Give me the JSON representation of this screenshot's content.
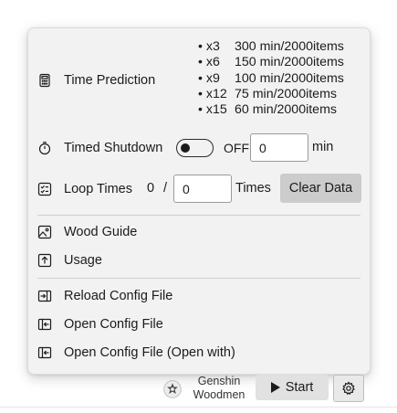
{
  "time_prediction": {
    "label": "Time Prediction",
    "icon": "calculator-icon",
    "entries": [
      {
        "multiplier": "x3",
        "time": "300 min/2000items"
      },
      {
        "multiplier": "x6",
        "time": "150 min/2000items"
      },
      {
        "multiplier": "x9",
        "time": "100 min/2000items"
      },
      {
        "multiplier": "x12",
        "time": "75 min/2000items"
      },
      {
        "multiplier": "x15",
        "time": "60 min/2000items"
      }
    ]
  },
  "timed_shutdown": {
    "label": "Timed Shutdown",
    "icon": "timer-icon",
    "toggle_state": "OFF",
    "toggle_on": false,
    "minutes_value": "0",
    "unit": "min"
  },
  "loop_times": {
    "label": "Loop Times",
    "icon": "checklist-icon",
    "current": "0",
    "divider": "/",
    "total_value": "0",
    "unit": "Times",
    "clear_button": "Clear Data"
  },
  "menu_group_1": [
    {
      "label": "Wood Guide",
      "icon": "image-icon"
    },
    {
      "label": "Usage",
      "icon": "upload-icon"
    }
  ],
  "menu_group_2": [
    {
      "label": "Reload Config File",
      "icon": "import-icon"
    },
    {
      "label": "Open Config File",
      "icon": "open-file-icon"
    },
    {
      "label": "Open Config File (Open with)",
      "icon": "open-file-with-icon"
    }
  ],
  "bottom_bar": {
    "app_name_line1": "Genshin",
    "app_name_line2": "Woodmen",
    "start_button": "Start",
    "settings_icon": "gear-icon"
  }
}
